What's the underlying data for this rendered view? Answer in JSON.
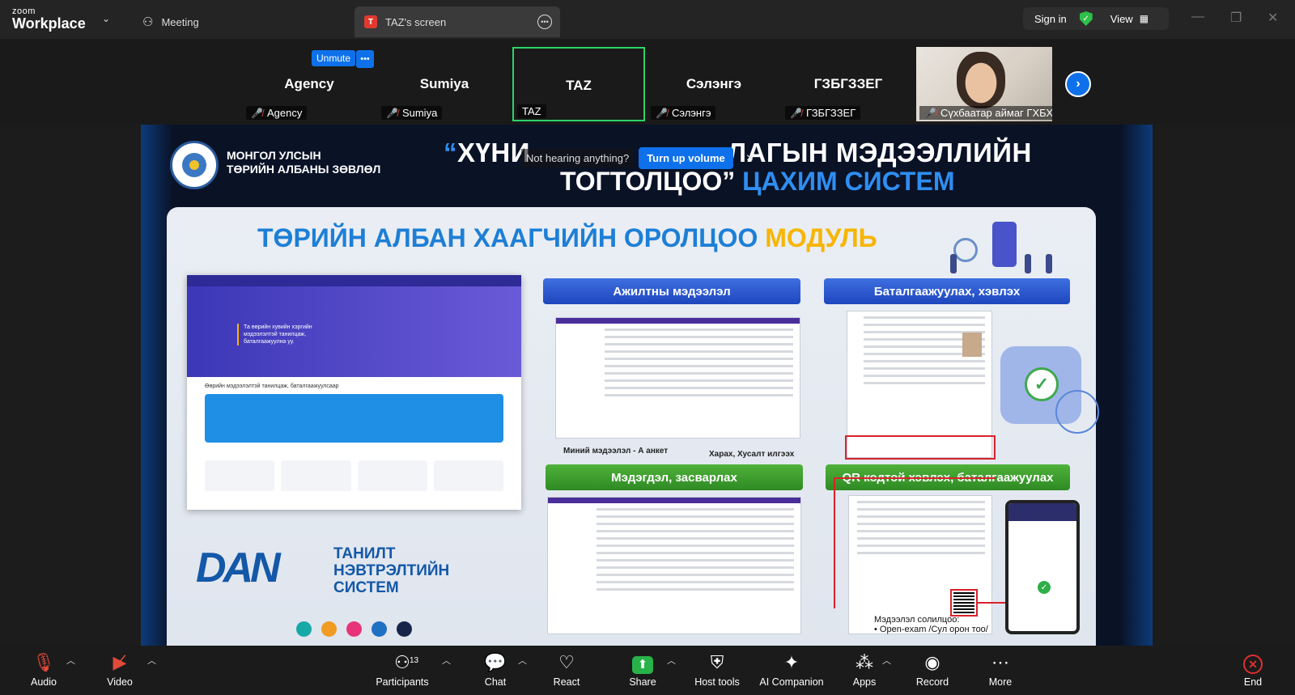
{
  "app": {
    "brand_top": "zoom",
    "brand_bottom": "Workplace"
  },
  "tabs": {
    "meeting": "Meeting",
    "screen": "TAZ's screen"
  },
  "top_right": {
    "sign_in": "Sign in",
    "view": "View"
  },
  "gallery": {
    "unmute": "Unmute",
    "tiles": [
      {
        "name": "Agency",
        "label": "Agency",
        "muted": true
      },
      {
        "name": "Sumiya",
        "label": "Sumiya",
        "muted": true
      },
      {
        "name": "TAZ",
        "label": "TAZ",
        "muted": false,
        "active": true
      },
      {
        "name": "Сэлэнгэ",
        "label": "Сэлэнгэ",
        "muted": true
      },
      {
        "name": "ГЗБГЗЗЕГ",
        "label": "ГЗБГЗЗЕГ",
        "muted": true
      }
    ],
    "video_label": "Сүхбаатар аймаг ГХБХ..."
  },
  "screen": {
    "org_line1": "МОНГОЛ УЛСЫН",
    "org_line2": "ТӨРИЙН АЛБАНЫ ЗӨВЛӨЛ",
    "head1_quote": "“",
    "head1_start": "ХҮНИ",
    "head1_end": "ЛАГЫН  МЭДЭЭЛЛИЙН",
    "head2_white": "ТОГТОЛЦОО”",
    "head2_blue": " ЦАХИМ СИСТЕМ",
    "notice_text": "Not hearing anything?",
    "notice_button": "Turn up volume",
    "notice_close": "×",
    "module_title": "ТӨРИЙН АЛБАН ХААГЧИЙН ОРОЛЦОО",
    "module_title_accent": " МОДУЛЬ",
    "portal_hero_text": "Та өөрийн хувийн хэргийн мэдээлэлтэй танилцаж, баталгаажуулна уу.",
    "portal_sub": "Өөрийн мэдээлэлтэй танилцаж, баталгаажуулсаар",
    "dan_logo": "DAN",
    "dan_line1": "ТАНИЛТ НЭВТРЭЛТИЙН",
    "dan_line2": "СИСТЕМ",
    "pill1": "Ажилтны мэдээлэл",
    "pill2": "Баталгаажуулах, хэвлэх",
    "pill3": "Мэдэгдэл, засварлах",
    "pill4": "QR кодтой хэвлэх, баталгаажуулах",
    "caption1": "Миний мэдээлэл - А анкет",
    "caption2": "Харах, Хусалт илгээх",
    "info_line1": "Мэдээлэл солилцоо:",
    "info_line2": "•  Open-exam /Сул орон тоо/",
    "dot_colors": [
      "#17a8a8",
      "#f29b24",
      "#e6337a",
      "#1f6fc2",
      "#16264a"
    ]
  },
  "toolbar": {
    "audio": "Audio",
    "video": "Video",
    "participants": "Participants",
    "participants_count": "13",
    "chat": "Chat",
    "react": "React",
    "share": "Share",
    "host_tools": "Host tools",
    "ai_companion": "AI Companion",
    "apps": "Apps",
    "record": "Record",
    "more": "More",
    "end": "End"
  }
}
